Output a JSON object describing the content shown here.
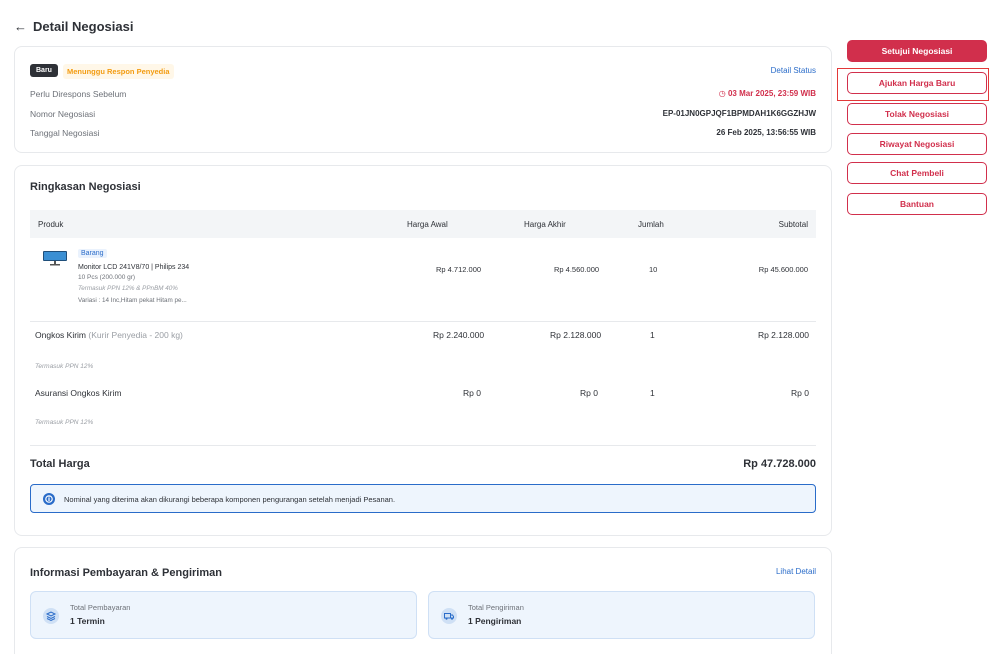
{
  "header": {
    "back_icon": "arrow-left-icon",
    "title": "Detail Negosiasi"
  },
  "status_card": {
    "badge_new": "Baru",
    "badge_status": "Menunggu Respon Penyedia",
    "detail_status_link": "Detail Status",
    "rows": [
      {
        "label": "Perlu Direspons Sebelum",
        "value": "03 Mar 2025, 23:59 WIB"
      },
      {
        "label": "Nomor Negosiasi",
        "value": "EP-01JN0GPJQF1BPMDAH1K6GGZHJW"
      },
      {
        "label": "Tanggal Negosiasi",
        "value": "26 Feb 2025, 13:56:55 WIB"
      }
    ]
  },
  "summary": {
    "title": "Ringkasan Negosiasi",
    "columns": [
      "Produk",
      "Harga Awal",
      "Harga Akhir",
      "Jumlah",
      "Subtotal"
    ],
    "product": {
      "tag": "Barang",
      "name": "Monitor LCD 241V8/70 | Philips 234",
      "qty_note": "10 Pcs (200.000 gr)",
      "tax_note": "Termasuk PPN 12% & PPnBM 40%",
      "variant": "Variasi   : 14 Inc,Hitam pekat Hitam pe...",
      "harga_awal": "Rp 4.712.000",
      "harga_akhir": "Rp 4.560.000",
      "jumlah": "10",
      "subtotal": "Rp 45.600.000"
    },
    "shipping": {
      "label": "Ongkos Kirim",
      "label_note": "(Kurir Penyedia - 200 kg)",
      "tax_note": "Termasuk PPN 12%",
      "harga_awal": "Rp 2.240.000",
      "harga_akhir": "Rp 2.128.000",
      "jumlah": "1",
      "subtotal": "Rp 2.128.000"
    },
    "insurance": {
      "label": "Asuransi Ongkos Kirim",
      "tax_note": "Termasuk PPN 12%",
      "harga_awal": "Rp 0",
      "harga_akhir": "Rp 0",
      "jumlah": "1",
      "subtotal": "Rp 0"
    },
    "total_label": "Total Harga",
    "total_value": "Rp 47.728.000",
    "notice": "Nominal yang diterima akan dikurangi beberapa komponen pengurangan setelah menjadi Pesanan."
  },
  "payment": {
    "title": "Informasi Pembayaran & Pengiriman",
    "link": "Lihat Detail",
    "payment_label": "Total Pembayaran",
    "payment_value": "1 Termin",
    "shipping_label": "Total Pengiriman",
    "shipping_value": "1 Pengiriman"
  },
  "actions": {
    "approve": "Setujui Negosiasi",
    "propose": "Ajukan Harga Baru",
    "reject": "Tolak Negosiasi",
    "history": "Riwayat Negosiasi",
    "chat": "Chat Pembeli",
    "help": "Bantuan"
  },
  "colors": {
    "primary": "#d12f4c",
    "link": "#2a6cc9",
    "warning": "#f39c12",
    "highlight": "#e23838"
  }
}
